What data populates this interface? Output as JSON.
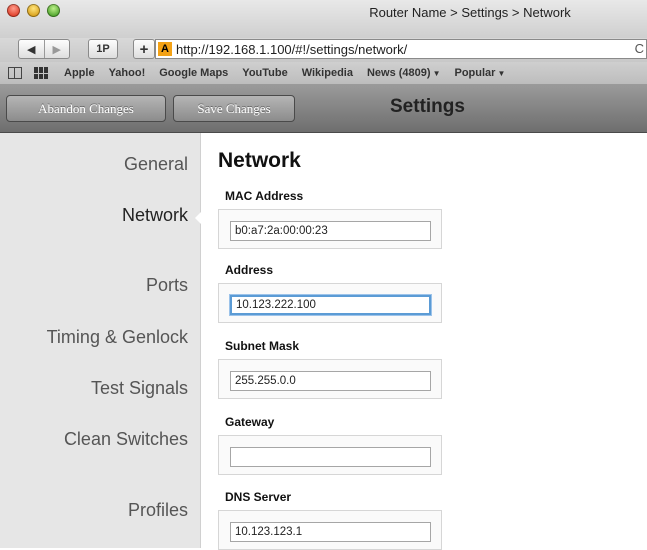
{
  "window": {
    "title": "Router Name > Settings > Network"
  },
  "navbar": {
    "one_password": "1P",
    "add": "+",
    "url": "http://192.168.1.100/#!/settings/network/",
    "reload": "C"
  },
  "bookmarks": [
    {
      "label": "Apple"
    },
    {
      "label": "Yahoo!"
    },
    {
      "label": "Google Maps"
    },
    {
      "label": "YouTube"
    },
    {
      "label": "Wikipedia"
    },
    {
      "label": "News (4809)",
      "dropdown": true
    },
    {
      "label": "Popular",
      "dropdown": true
    }
  ],
  "toolbar": {
    "abandon_label": "Abandon Changes",
    "save_label": "Save Changes",
    "title": "Settings"
  },
  "sidebar": {
    "items": [
      {
        "label": "General"
      },
      {
        "label": "Network",
        "active": true
      },
      {
        "label": "Ports"
      },
      {
        "label": "Timing & Genlock"
      },
      {
        "label": "Test Signals"
      },
      {
        "label": "Clean Switches"
      },
      {
        "label": "Profiles"
      }
    ]
  },
  "main": {
    "title": "Network",
    "fields": [
      {
        "label": "MAC Address",
        "value": "b0:a7:2a:00:00:23"
      },
      {
        "label": "Address",
        "value": "10.123.222.100",
        "focused": true
      },
      {
        "label": "Subnet Mask",
        "value": "255.255.0.0"
      },
      {
        "label": "Gateway",
        "value": ""
      },
      {
        "label": "DNS Server",
        "value": "10.123.123.1"
      }
    ]
  }
}
